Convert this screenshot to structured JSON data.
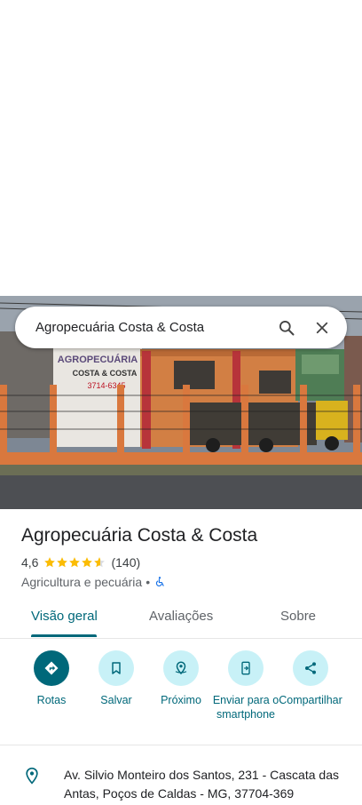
{
  "search": {
    "query": "Agropecuária Costa & Costa"
  },
  "photo": {
    "sign_line1": "AGROPECUÁRIA",
    "sign_line2": "COSTA & COSTA",
    "sign_line3": "3714-6345"
  },
  "place": {
    "name": "Agropecuária Costa & Costa",
    "rating": "4,6",
    "rating_value": 4.6,
    "review_count": "(140)",
    "category": "Agricultura e pecuária",
    "separator": "•",
    "accessibility_icon": "wheelchair-icon"
  },
  "tabs": [
    {
      "label": "Visão geral",
      "active": true
    },
    {
      "label": "Avaliações",
      "active": false
    },
    {
      "label": "Sobre",
      "active": false
    }
  ],
  "actions": [
    {
      "label": "Rotas",
      "icon": "directions-icon"
    },
    {
      "label": "Salvar",
      "icon": "bookmark-icon"
    },
    {
      "label": "Próximo",
      "icon": "nearby-icon"
    },
    {
      "label": "Enviar para o smartphone",
      "icon": "send-to-phone-icon"
    },
    {
      "label": "Compartilhar",
      "icon": "share-icon"
    }
  ],
  "address": {
    "text": "Av. Silvio Monteiro dos Santos, 231 - Cascata das Antas, Poços de Caldas - MG, 37704-369",
    "icon": "location-pin-icon"
  },
  "colors": {
    "accent": "#00687a",
    "accent_light": "#c8f1f7",
    "star": "#fbbc04"
  }
}
